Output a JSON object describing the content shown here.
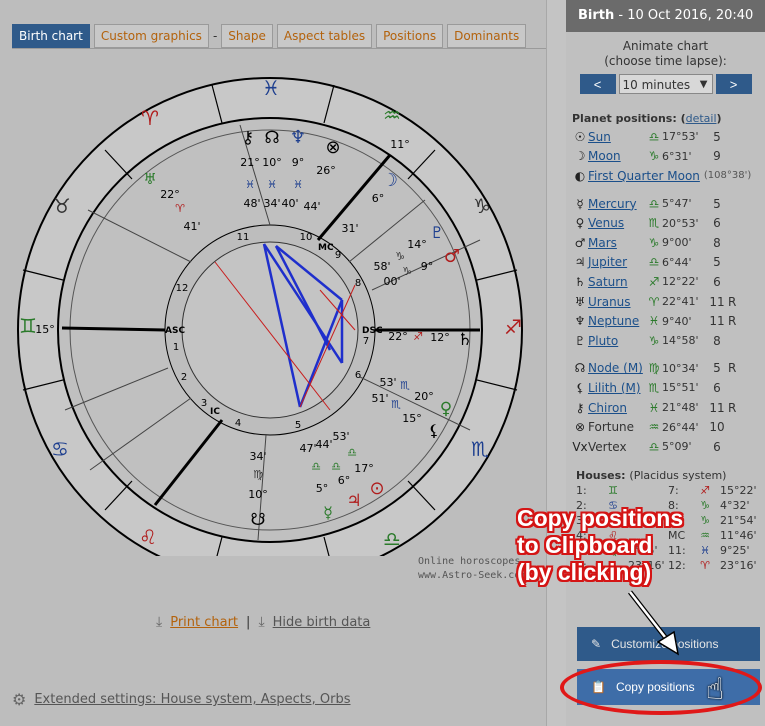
{
  "tabs": {
    "birth_chart": "Birth chart",
    "custom_graphics": "Custom graphics",
    "separator": "-",
    "shape": "Shape",
    "aspect_tables": "Aspect tables",
    "positions": "Positions",
    "dominants": "Dominants"
  },
  "chart": {
    "watermark_line1": "Online horoscopes",
    "watermark_line2": "www.Astro-Seek.com",
    "house_numbers": [
      "1",
      "2",
      "3",
      "4",
      "5",
      "6",
      "7",
      "8",
      "9",
      "10",
      "11",
      "12"
    ],
    "angle_labels": {
      "asc": "ASC",
      "dsc": "DSC",
      "mc": "MC",
      "ic": "IC"
    },
    "outer_degrees": {
      "left": "15°",
      "top_right": "11°",
      "right": "22°",
      "right2": "12°",
      "left_top": "22°",
      "left_top2": "41'"
    }
  },
  "links": {
    "print_chart": "Print chart",
    "separator": "|",
    "hide_birth_data": "Hide birth data",
    "extended_settings": "Extended settings: House system, Aspects, Orbs"
  },
  "side": {
    "title_bold": "Birth",
    "title_rest": " - 10 Oct 2016, 20:40",
    "animate_line1": "Animate chart",
    "animate_line2": "(choose time lapse):",
    "prev": "<",
    "next": ">",
    "lapse": "10 minutes",
    "planets_title": "Planet positions:",
    "detail_link": "detail",
    "planets": [
      {
        "glyph": "☉",
        "name": "Sun",
        "sign": "♎",
        "deg": "17°53'",
        "house": "5",
        "r": ""
      },
      {
        "glyph": "☽",
        "name": "Moon",
        "sign": "♑",
        "deg": "6°31'",
        "house": "9",
        "r": ""
      }
    ],
    "moonphase": {
      "glyph": "◐",
      "name": "First Quarter Moon",
      "deg": "(108°38')"
    },
    "planets2": [
      {
        "glyph": "☿",
        "name": "Mercury",
        "sign": "♎",
        "deg": "5°47'",
        "house": "5",
        "r": ""
      },
      {
        "glyph": "♀",
        "name": "Venus",
        "sign": "♏",
        "deg": "20°53'",
        "house": "6",
        "r": ""
      },
      {
        "glyph": "♂",
        "name": "Mars",
        "sign": "♑",
        "deg": "9°00'",
        "house": "8",
        "r": ""
      },
      {
        "glyph": "♃",
        "name": "Jupiter",
        "sign": "♎",
        "deg": "6°44'",
        "house": "5",
        "r": ""
      },
      {
        "glyph": "♄",
        "name": "Saturn",
        "sign": "♐",
        "deg": "12°22'",
        "house": "6",
        "r": ""
      },
      {
        "glyph": "♅",
        "name": "Uranus",
        "sign": "♈",
        "deg": "22°41'",
        "house": "11",
        "r": "R"
      },
      {
        "glyph": "♆",
        "name": "Neptune",
        "sign": "♓",
        "deg": "9°40'",
        "house": "11",
        "r": "R"
      },
      {
        "glyph": "♇",
        "name": "Pluto",
        "sign": "♑",
        "deg": "14°58'",
        "house": "8",
        "r": ""
      }
    ],
    "planets3": [
      {
        "glyph": "☊",
        "name": "Node (M)",
        "sign": "♍",
        "deg": "10°34'",
        "house": "5",
        "r": "R"
      },
      {
        "glyph": "⚸",
        "name": "Lilith (M)",
        "sign": "♏",
        "deg": "15°51'",
        "house": "6",
        "r": ""
      },
      {
        "glyph": "⚷",
        "name": "Chiron",
        "sign": "♓",
        "deg": "21°48'",
        "house": "11",
        "r": "R"
      },
      {
        "glyph": "⊗",
        "name": "Fortune",
        "sign": "♒",
        "deg": "26°44'",
        "house": "10",
        "r": ""
      },
      {
        "glyph": "Vx",
        "name": "Vertex",
        "sign": "♎",
        "deg": "5°09'",
        "house": "6",
        "r": ""
      }
    ],
    "houses_title": "Houses:",
    "houses_system": "(Placidus system)",
    "houses": [
      {
        "n": "1:",
        "sign": "♊",
        "deg": "",
        "n2": "7:",
        "sign2": "♐",
        "deg2": "15°22'"
      },
      {
        "n": "2:",
        "sign": "♋",
        "deg": "",
        "n2": "8:",
        "sign2": "♑",
        "deg2": "4°32'"
      },
      {
        "n": "3:",
        "sign": "♋",
        "deg": "",
        "n2": "9:",
        "sign2": "♑",
        "deg2": "21°54'"
      },
      {
        "n": "4:",
        "sign": "♌",
        "deg": "",
        "n2": "MC",
        "sign2": "♒",
        "deg2": "11°46'"
      },
      {
        "n": "5:",
        "sign": "♍",
        "deg": "9°25'",
        "n2": "11:",
        "sign2": "♓",
        "deg2": "9°25'"
      },
      {
        "n": "6:",
        "sign": "♏",
        "deg": "23°16'",
        "n2": "12:",
        "sign2": "♈",
        "deg2": "23°16'"
      }
    ],
    "customize_button": "Customize positions",
    "copy_button": "Copy positions"
  },
  "annotation": {
    "line1": "Copy positions",
    "line2": "to Clipboard",
    "line3": "(by clicking)"
  },
  "colors": {
    "accent": "#2f5a8a",
    "link_orange": "#b3620c",
    "annotation_red": "#e01818",
    "aspect_blue": "#1f2fcc",
    "aspect_red": "#c81d1d"
  }
}
